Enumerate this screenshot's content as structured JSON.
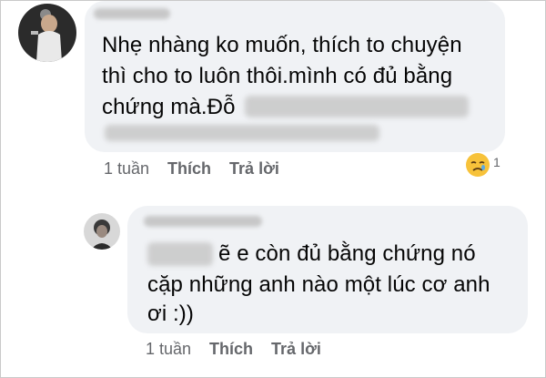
{
  "comment1": {
    "lines": [
      "Nhẹ nhàng ko muốn, thích to chuyện",
      "thì cho to luôn thôi.mình có đủ bằng",
      "chứng mà.Đỗ"
    ],
    "time": "1 tuần",
    "like_label": "Thích",
    "reply_label": "Trả lời",
    "reaction_count": "1",
    "reaction_icon": "crying-face-icon"
  },
  "comment2": {
    "lines": [
      "ẽ e còn đủ bằng chứng nó",
      "cặp những anh nào một lúc cơ anh",
      "ơi :))"
    ],
    "time": "1 tuần",
    "like_label": "Thích",
    "reply_label": "Trả lời"
  },
  "colors": {
    "bubble": "#f0f2f5",
    "text": "#050505",
    "meta": "#65676b",
    "redaction": "#c8c8c8"
  }
}
